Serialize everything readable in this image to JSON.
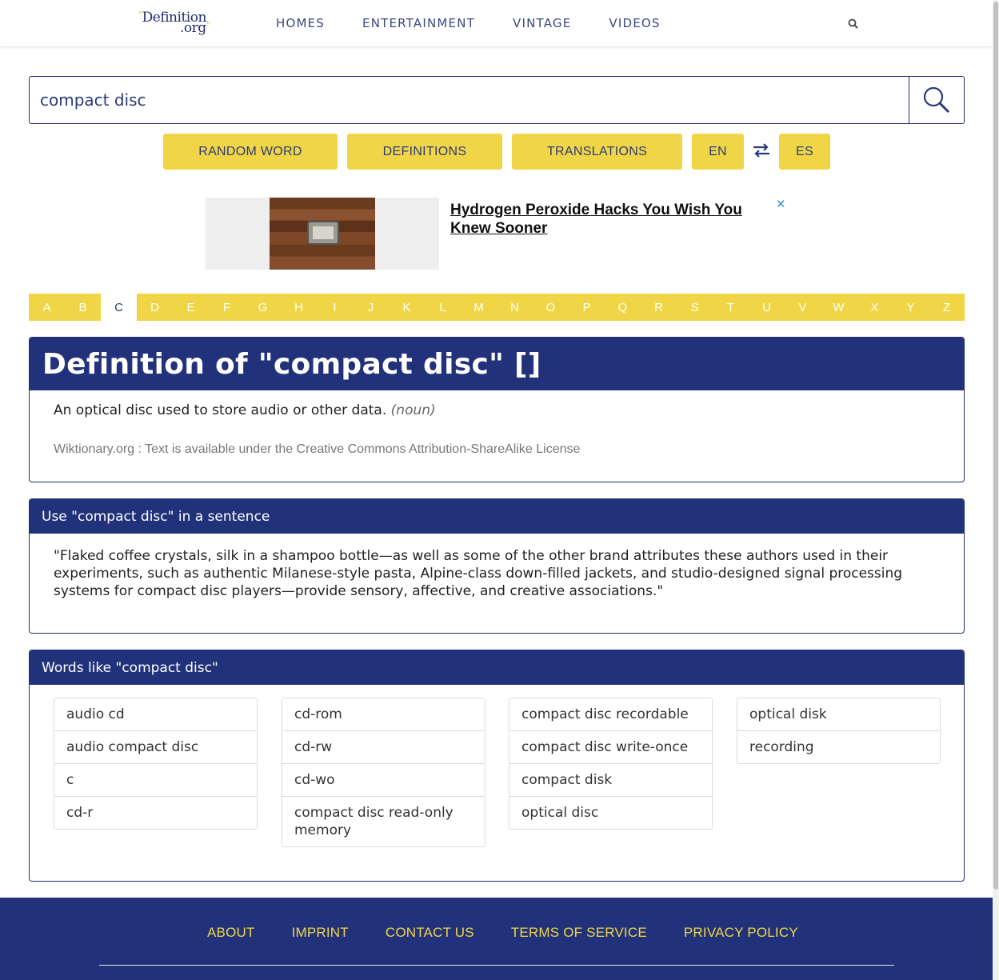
{
  "header": {
    "logo_main": "Definition",
    "logo_tld": ".org",
    "nav": [
      "HOMES",
      "ENTERTAINMENT",
      "VINTAGE",
      "VIDEOS"
    ]
  },
  "search": {
    "value": "compact disc"
  },
  "buttons": {
    "random_word": "RANDOM WORD",
    "definitions": "DEFINITIONS",
    "translations": "TRANSLATIONS",
    "lang_from": "EN",
    "lang_to": "ES"
  },
  "ad": {
    "title": "Hydrogen Peroxide Hacks You Wish You Knew Sooner",
    "close": "✕"
  },
  "alphabet": {
    "letters": [
      "A",
      "B",
      "C",
      "D",
      "E",
      "F",
      "G",
      "H",
      "I",
      "J",
      "K",
      "L",
      "M",
      "N",
      "O",
      "P",
      "Q",
      "R",
      "S",
      "T",
      "U",
      "V",
      "W",
      "X",
      "Y",
      "Z"
    ],
    "active": "C"
  },
  "definition": {
    "title": "Definition of \"compact disc\" []",
    "text": "An optical disc used to store audio or other data.",
    "part_of_speech": "(noun)",
    "source": "Wiktionary.org : Text is available under the Creative Commons Attribution-ShareAlike License"
  },
  "sentence": {
    "title": "Use \"compact disc\" in a sentence",
    "text": "\"Flaked coffee crystals, silk in a shampoo bottle—as well as some of the other brand attributes these authors used in their experiments, such as authentic Milanese-style pasta, Alpine-class down-filled jackets, and studio-designed signal processing systems for compact disc players—provide sensory, affective, and creative associations.\""
  },
  "words_like": {
    "title": "Words like \"compact disc\"",
    "columns": [
      [
        "audio cd",
        "audio compact disc",
        "c",
        "cd-r"
      ],
      [
        "cd-rom",
        "cd-rw",
        "cd-wo",
        "compact disc read-only memory"
      ],
      [
        "compact disc recordable",
        "compact disc write-once",
        "compact disk",
        "optical disc"
      ],
      [
        "optical disk",
        "recording"
      ]
    ]
  },
  "footer": {
    "links": [
      "ABOUT",
      "IMPRINT",
      "CONTACT US",
      "TERMS OF SERVICE",
      "PRIVACY POLICY"
    ]
  },
  "colors": {
    "navy": "#22327a",
    "yellow": "#f0d646",
    "link_blue": "#3a4880"
  }
}
